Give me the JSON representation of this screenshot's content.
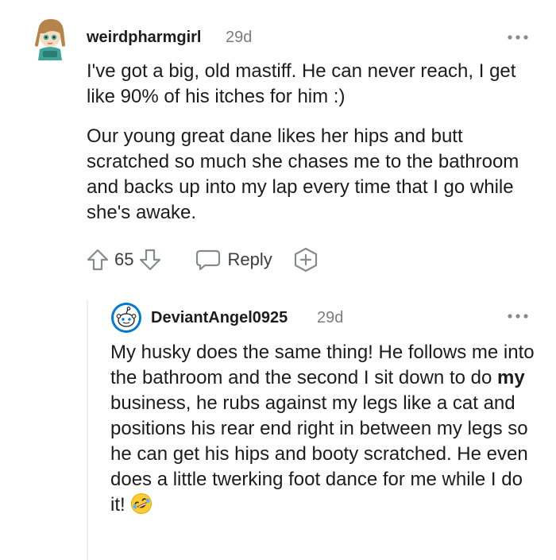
{
  "comment": {
    "username": "weirdpharmgirl",
    "time": "29d",
    "paragraphs": [
      "I've got a big, old mastiff. He can never reach, I get like 90% of his itches for him :)",
      "Our young great dane likes her hips and butt scratched so much she chases me to the bathroom and backs up into my lap every time that I go while she's awake."
    ],
    "votes": "65",
    "reply_label": "Reply",
    "icons": {
      "avatar": "cartoon-girl-avatar",
      "more": "more-options-icon",
      "upvote": "upvote-arrow-icon",
      "downvote": "downvote-arrow-icon",
      "reply": "reply-bubble-icon",
      "award": "plus-award-icon"
    }
  },
  "reply": {
    "username": "DeviantAngel0925",
    "time": "29d",
    "text_before": "My husky does the same thing! He follows me into the bathroom and the second I sit down to do ",
    "text_bold": "my",
    "text_after": " business, he rubs against my legs like a cat and positions his rear end right in between my legs so he can get his hips and booty scratched. He even does a little twerking foot dance for me while I do it!",
    "icons": {
      "avatar": "default-snoo-avatar",
      "more": "more-options-icon",
      "emoji": "rolling-laughing-emoji"
    }
  },
  "colors": {
    "text": "#1c1c1c",
    "meta": "#7c7c7c",
    "icon": "#878a8c",
    "thread_line": "#edeff1",
    "avatar_blue": "#0079d3"
  }
}
